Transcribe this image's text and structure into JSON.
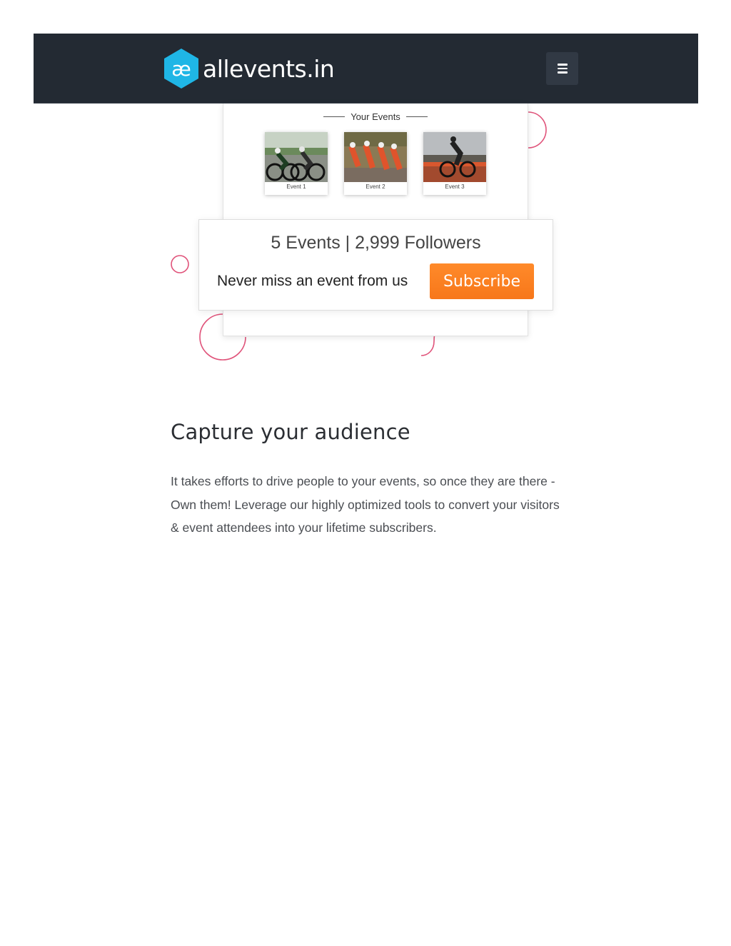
{
  "header": {
    "logo_text": "allevents.in",
    "logo_mark": "æ",
    "menu_icon": "hamburger-menu-icon"
  },
  "illustration": {
    "section_label": "Your Events",
    "events": [
      {
        "caption": "Event 1"
      },
      {
        "caption": "Event 2"
      },
      {
        "caption": "Event 3"
      }
    ],
    "stats": "5 Events | 2,999 Followers",
    "tagline": "Never miss an event from us",
    "subscribe_label": "Subscribe"
  },
  "content": {
    "title": "Capture your audience",
    "paragraph": "It takes efforts to drive people to your events, so once they are there - Own them! Leverage our highly optimized tools to convert your visitors & event attendees into your lifetime subscribers."
  },
  "colors": {
    "header_bg": "#232a33",
    "logo_accent": "#1fb6e6",
    "subscribe_orange": "#f7771a",
    "decoration_pink": "#e0537a"
  }
}
